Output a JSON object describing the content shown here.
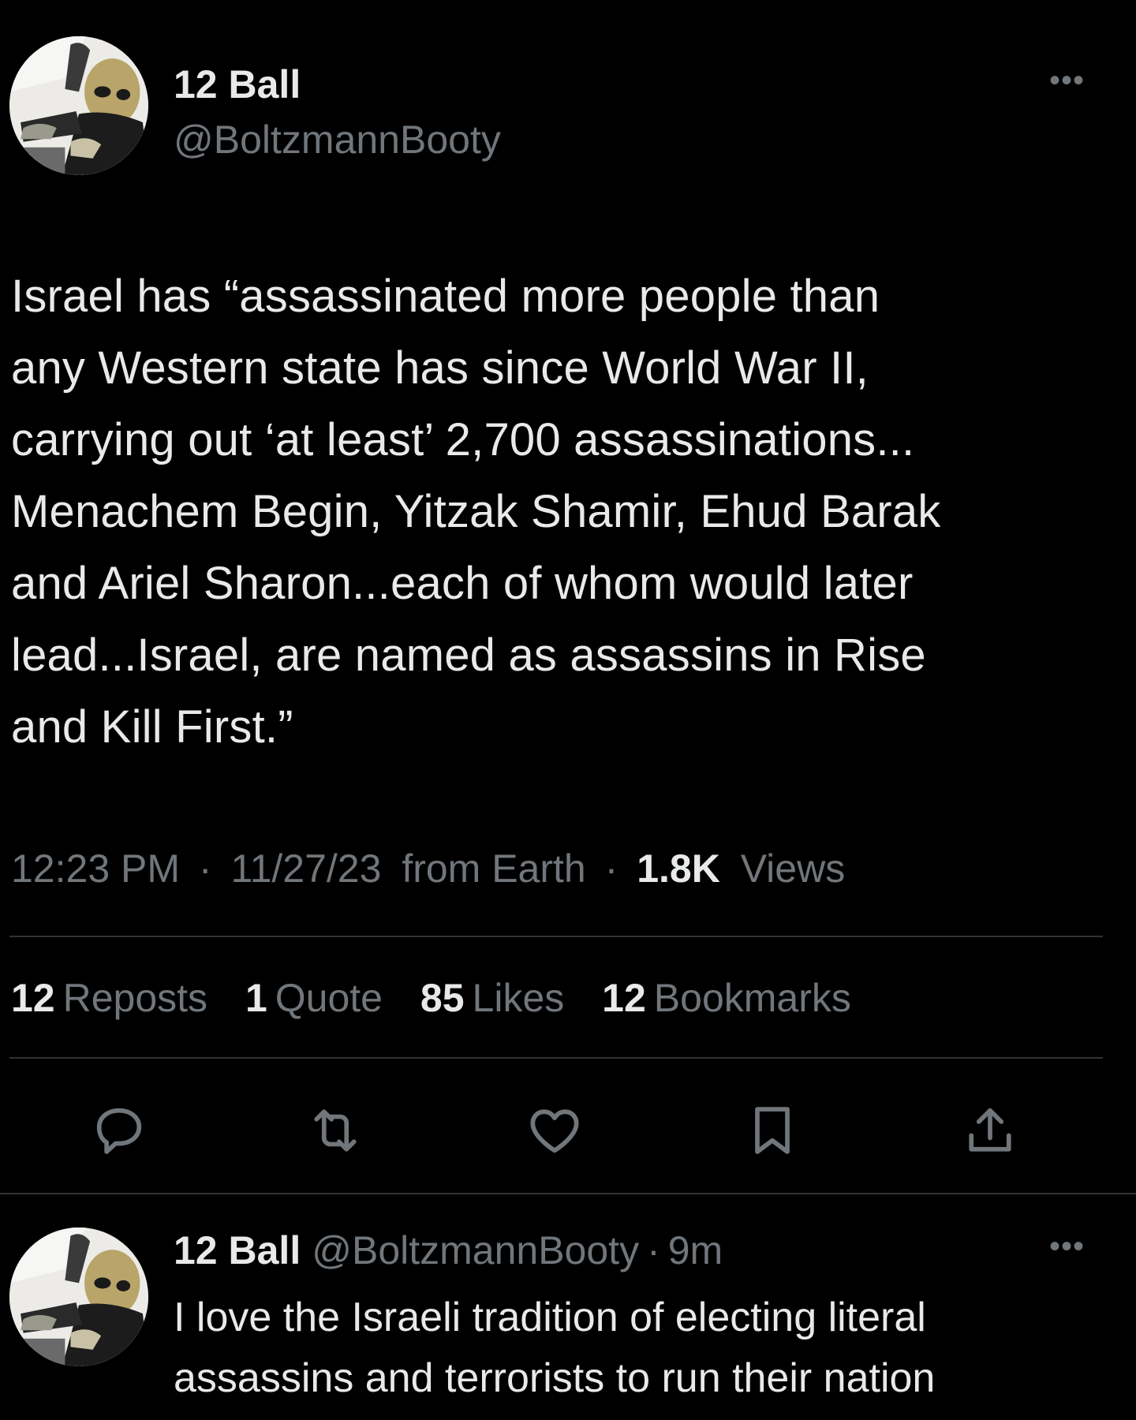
{
  "tweet": {
    "author": {
      "display_name": "12 Ball",
      "handle": "@BoltzmannBooty",
      "avatar_icon": "alien-avatar"
    },
    "more_label": "•••",
    "text_lines": [
      "Israel has “assassinated more people than",
      "any Western state has since World War II,",
      "carrying out ‘at least’ 2,700 assassinations...",
      "Menachem Begin, Yitzak Shamir, Ehud Barak",
      "and Ariel Sharon...each of whom would later",
      "lead...Israel, are named as assassins in Rise",
      "and Kill First.”"
    ],
    "meta": {
      "time": "12:23 PM",
      "date": "11/27/23",
      "source": "from Earth",
      "separator": "·",
      "views_count": "1.8K",
      "views_label": "Views"
    },
    "stats": [
      {
        "count": "12",
        "label": "Reposts"
      },
      {
        "count": "1",
        "label": "Quote"
      },
      {
        "count": "85",
        "label": "Likes"
      },
      {
        "count": "12",
        "label": "Bookmarks"
      }
    ],
    "actions": [
      "reply-icon",
      "repost-icon",
      "like-icon",
      "bookmark-icon",
      "share-icon"
    ]
  },
  "reply": {
    "display_name": "12 Ball",
    "handle": "@BoltzmannBooty",
    "separator": "·",
    "time": "9m",
    "more_label": "•••",
    "text_lines": [
      "I love the Israeli tradition of electing literal",
      "assassins and terrorists to run their nation"
    ]
  },
  "colors": {
    "background": "#000000",
    "text_primary": "#e7e9ea",
    "text_secondary": "#71767b",
    "divider": "#2f3336"
  }
}
